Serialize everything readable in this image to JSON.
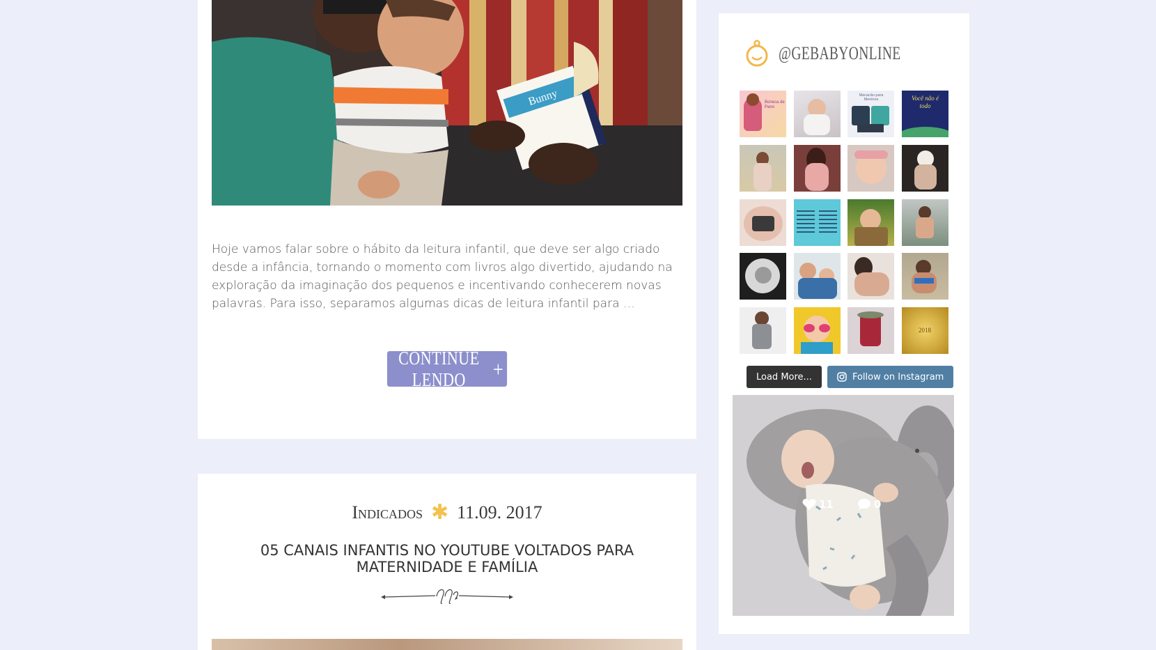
{
  "post_one": {
    "excerpt": "Hoje vamos falar sobre o hábito da leitura infantil, que deve ser algo criado desde a infância, tornando o momento com livros algo divertido, ajudando na exploração da imaginação dos pequenos e incentivando conhecerem novas palavras. Para isso, separamos algumas dicas de leitura infantil para …",
    "continue_label": "Continue lendo",
    "book_title": "Bunny"
  },
  "post_two": {
    "category": "Indicados",
    "date": "11.09. 2017",
    "title": "05 canais infantis no YouTube voltados para maternidade e família"
  },
  "sidebar": {
    "instagram_handle": "@gebabyonline",
    "thumbs": [
      {
        "caption": "Boneca de Pano"
      },
      {
        "caption": ""
      },
      {
        "caption": "Macacão para Meninos"
      },
      {
        "caption": "Você não é todo"
      },
      {
        "caption": ""
      },
      {
        "caption": ""
      },
      {
        "caption": ""
      },
      {
        "caption": ""
      },
      {
        "caption": ""
      },
      {
        "caption": ""
      },
      {
        "caption": ""
      },
      {
        "caption": ""
      },
      {
        "caption": ""
      },
      {
        "caption": ""
      },
      {
        "caption": ""
      },
      {
        "caption": ""
      },
      {
        "caption": ""
      },
      {
        "caption": ""
      },
      {
        "caption": ""
      },
      {
        "caption": "2018"
      }
    ],
    "load_more_label": "Load More...",
    "follow_label": "Follow on Instagram",
    "featured": {
      "likes": "11",
      "comments": "0"
    }
  },
  "colors": {
    "page_bg": "#eceef9",
    "accent": "#8c8fcc",
    "asterisk": "#f3c24e",
    "follow_button": "#517fa4"
  }
}
